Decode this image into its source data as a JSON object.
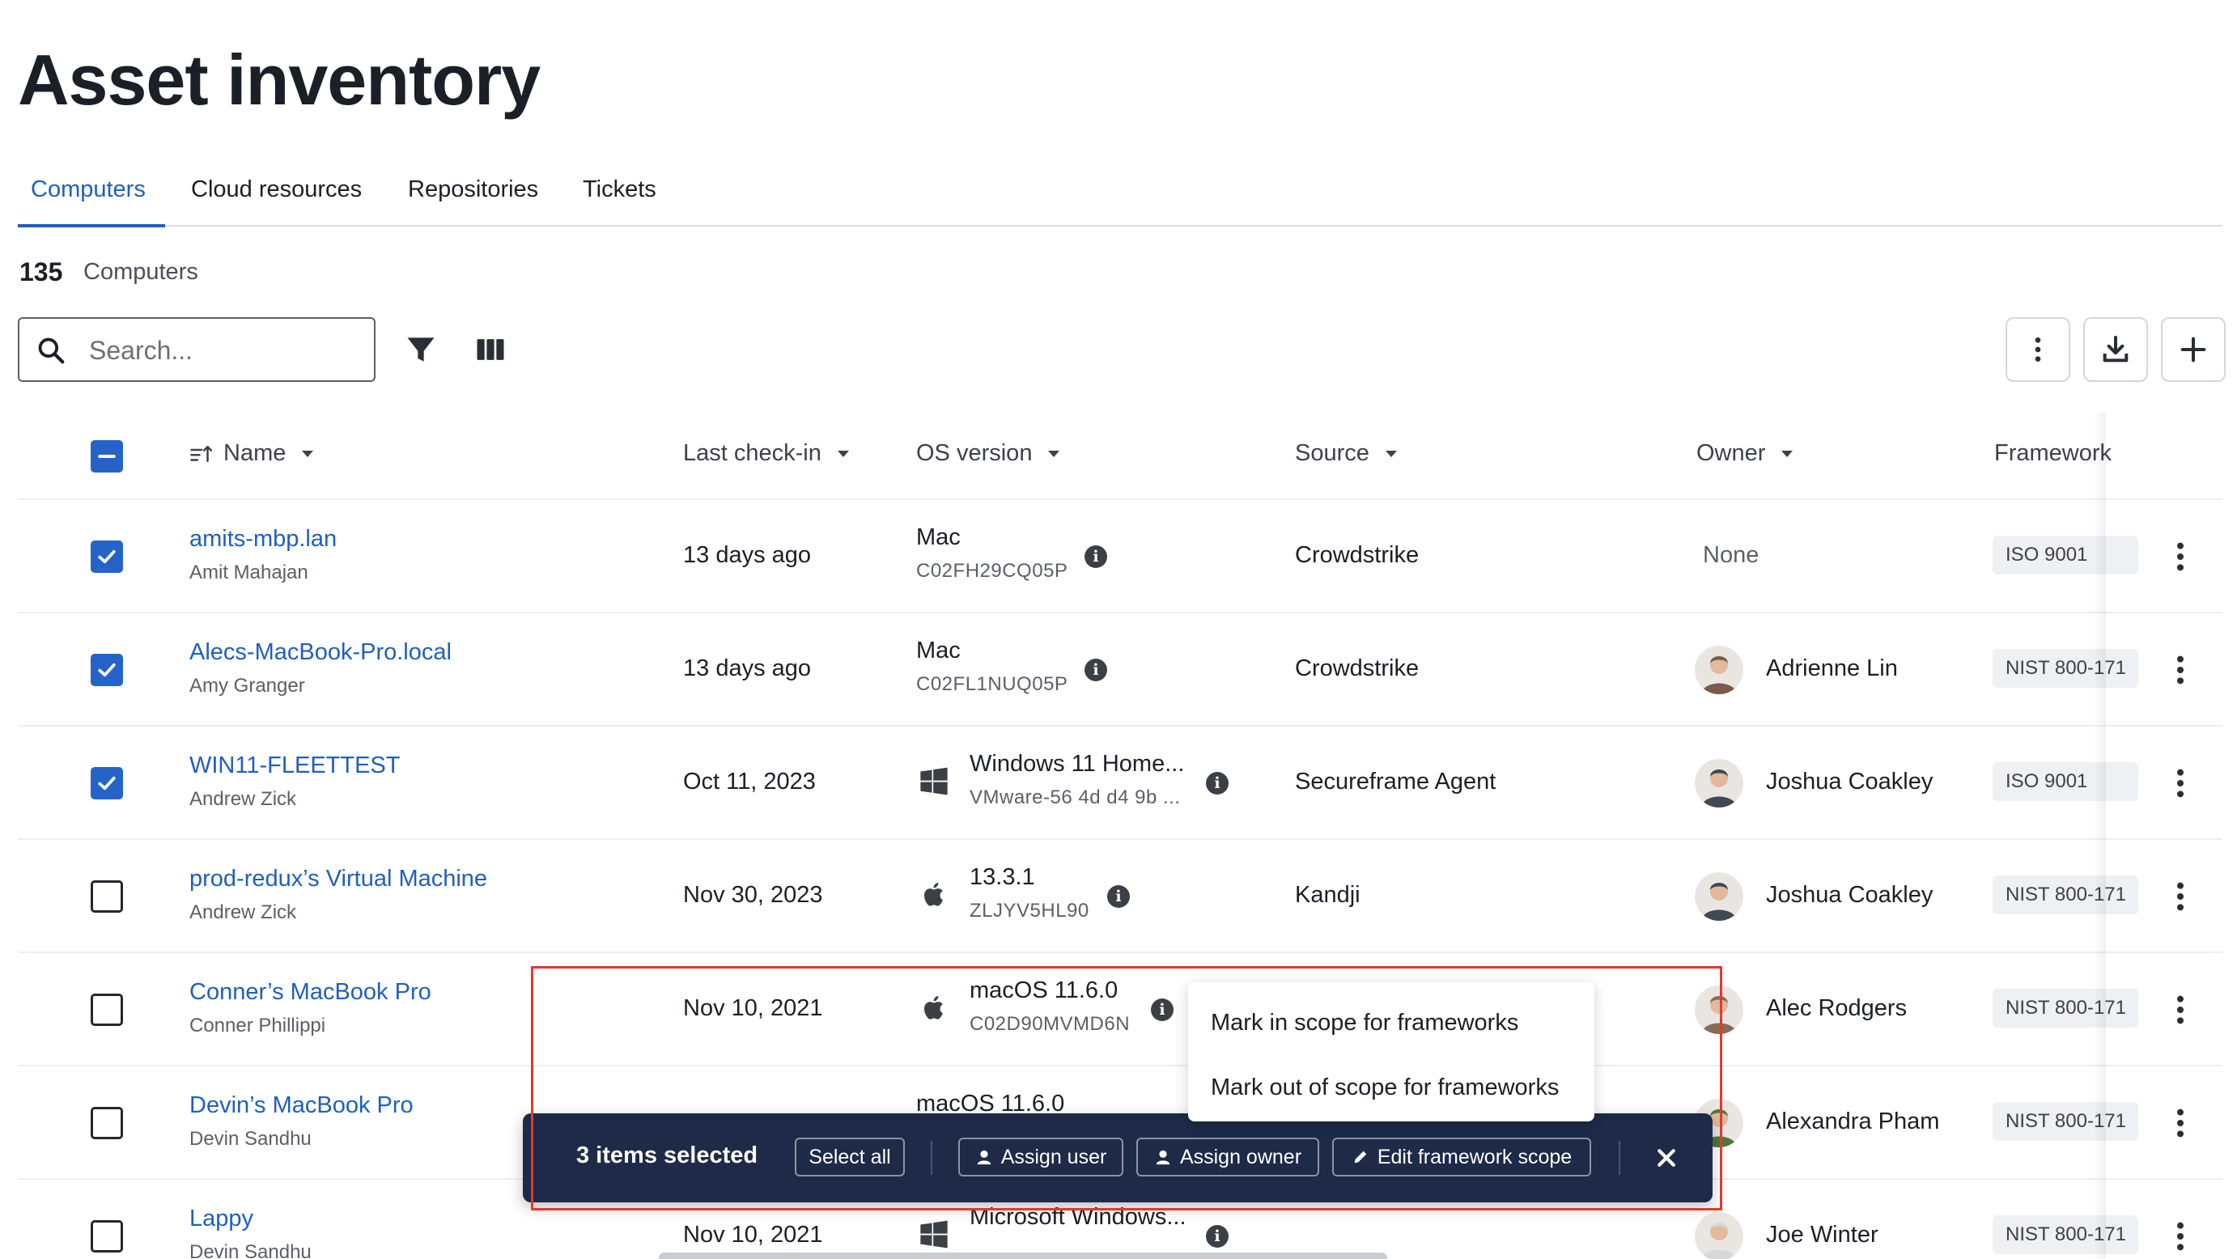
{
  "page": {
    "title": "Asset inventory"
  },
  "tabs": [
    {
      "label": "Computers",
      "active": true
    },
    {
      "label": "Cloud resources",
      "active": false
    },
    {
      "label": "Repositories",
      "active": false
    },
    {
      "label": "Tickets",
      "active": false
    }
  ],
  "summary": {
    "count": "135",
    "label": "Computers"
  },
  "search": {
    "placeholder": "Search...",
    "value": ""
  },
  "toolbar": {
    "icons": [
      "filter-icon",
      "columns-icon",
      "more-vertical-icon",
      "download-icon",
      "plus-icon"
    ]
  },
  "table": {
    "columns": [
      "Name",
      "Last check-in",
      "OS version",
      "Source",
      "Owner",
      "Framework"
    ],
    "rows": [
      {
        "checked": true,
        "name": "amits-mbp.lan",
        "user": "Amit Mahajan",
        "checkin": "13 days ago",
        "os": "Mac",
        "os_sub": "C02FH29CQ05P",
        "os_icon": "none",
        "source": "Crowdstrike",
        "owner": "None",
        "framework": "ISO 9001"
      },
      {
        "checked": true,
        "name": "Alecs-MacBook-Pro.local",
        "user": "Amy Granger",
        "checkin": "13 days ago",
        "os": "Mac",
        "os_sub": "C02FL1NUQ05P",
        "os_icon": "none",
        "source": "Crowdstrike",
        "owner": "Adrienne Lin",
        "framework": "NIST 800-171"
      },
      {
        "checked": true,
        "name": "WIN11-FLEETTEST",
        "user": "Andrew Zick",
        "checkin": "Oct 11, 2023",
        "os": "Windows 11 Home...",
        "os_sub": "VMware-56 4d d4 9b ...",
        "os_icon": "windows-icon",
        "source": "Secureframe Agent",
        "owner": "Joshua Coakley",
        "framework": "ISO 9001"
      },
      {
        "checked": false,
        "name": "prod-redux’s Virtual Machine",
        "user": "Andrew Zick",
        "checkin": "Nov 30, 2023",
        "os": "13.3.1",
        "os_sub": "ZLJYV5HL90",
        "os_icon": "apple-icon",
        "source": "Kandji",
        "owner": "Joshua Coakley",
        "framework": "NIST 800-171"
      },
      {
        "checked": false,
        "name": "Conner’s MacBook Pro",
        "user": "Conner Phillippi",
        "checkin": "Nov 10, 2021",
        "os": "macOS 11.6.0",
        "os_sub": "C02D90MVMD6N",
        "os_icon": "apple-icon",
        "source": "",
        "owner": "Alec Rodgers",
        "framework": "NIST 800-171"
      },
      {
        "checked": false,
        "name": "Devin’s MacBook Pro",
        "user": "Devin Sandhu",
        "checkin": "",
        "os": "macOS 11.6.0",
        "os_sub": "",
        "os_icon": "none",
        "source": "",
        "owner": "Alexandra Pham",
        "framework": "NIST 800-171"
      },
      {
        "checked": false,
        "name": "Lappy",
        "user": "Devin Sandhu",
        "checkin": "Nov 10, 2021",
        "os": "Microsoft Windows...",
        "os_sub": "",
        "os_icon": "windows-icon",
        "source": "",
        "owner": "Joe Winter",
        "framework": "NIST 800-171"
      }
    ]
  },
  "bulk_bar": {
    "count_text": "3 items selected",
    "select_all": "Select all",
    "assign_user": "Assign user",
    "assign_owner": "Assign owner",
    "edit_scope": "Edit framework scope"
  },
  "scope_menu": {
    "items": [
      "Mark in scope for frameworks",
      "Mark out of scope for frameworks"
    ]
  },
  "colors": {
    "accent": "#1f5fbf",
    "checkbox": "#2563c9",
    "bulk_bar": "#1e2a47",
    "highlight": "#e23a2e"
  }
}
